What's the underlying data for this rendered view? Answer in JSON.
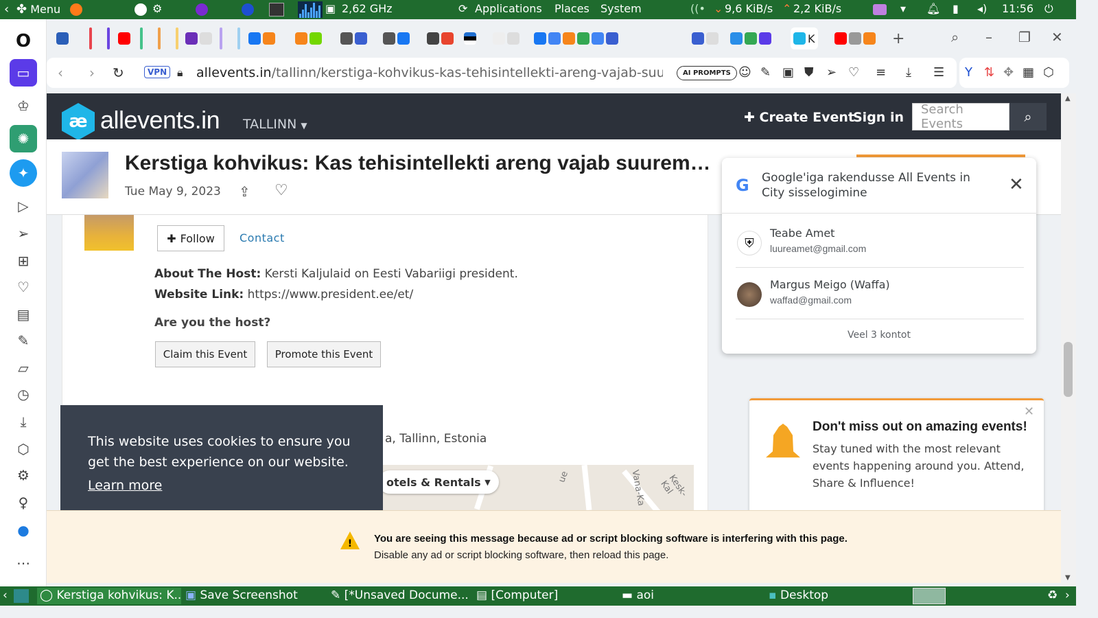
{
  "os_panel": {
    "menu_label": "Menu",
    "cpu_freq": "2,62 GHz",
    "applications": "Applications",
    "places": "Places",
    "system": "System",
    "net_down": "9,6 KiB/s",
    "net_up": "2,2 KiB/s",
    "clock": "11:56"
  },
  "browser": {
    "active_tab_letter": "K",
    "vpn_label": "VPN",
    "url_domain": "allevents.in",
    "url_path": "/tallinn/kerstiga-kohvikus-kas-tehisintellekti-areng-vajab-suurem",
    "ai_prompts": "AI PROMPTS"
  },
  "site": {
    "logo_mark": "æ",
    "logo_text": "allevents.in",
    "city": "TALLINN",
    "create_event": "Create Event",
    "sign_in": "Sign in",
    "search_placeholder": "Search Events"
  },
  "event": {
    "title": "Kerstiga kohvikus: Kas tehisintellekti areng vajab suurem…",
    "date": "Tue May 9, 2023"
  },
  "host": {
    "follow_label": "Follow",
    "contact_label": "Contact",
    "about_label": "About The Host:",
    "about_text": "Kersti Kaljulaid on Eesti Vabariigi president.",
    "website_label": "Website Link:",
    "website_url": "https://www.president.ee/et/",
    "question": "Are you the host?",
    "claim_label": "Claim this Event",
    "promote_label": "Promote this Event",
    "address_tail": "a, Tallinn, Estonia"
  },
  "map": {
    "hotels_label": "otels & Rentals",
    "labels": [
      "ue",
      "Vana-Ka",
      "Kesk-Kal"
    ]
  },
  "cookie": {
    "text": "This website uses cookies to ensure you get the best experience on our website.",
    "learn_more": "Learn more"
  },
  "google_signin": {
    "title": "Google'iga rakendusse All Events in City sisselogimine",
    "accounts": [
      {
        "name": "Teabe Amet",
        "email": "luureamet@gmail.com"
      },
      {
        "name": "Margus Meigo (Waffa)",
        "email": "waffad@gmail.com"
      }
    ],
    "more": "Veel 3 kontot"
  },
  "notify": {
    "title": "Don't miss out on amazing events!",
    "text": "Stay tuned with the most relevant events happening around you. Attend, Share & Influence!"
  },
  "adblock_warning": {
    "title": "You are seeing this message because ad or script blocking software is interfering with this page.",
    "body": "Disable any ad or script blocking software, then reload this page."
  },
  "taskbar": {
    "items": [
      "Kerstiga kohvikus: K...",
      "Save Screenshot",
      "[*Unsaved Docume...",
      "[Computer]",
      "aoi",
      "Desktop"
    ]
  },
  "colors": {
    "os_panel": "#1f6b2e",
    "site_header": "#2c313a",
    "brand_accent": "#1fb6e8",
    "cookie_bg": "#39414e",
    "notify_accent": "#f29a38",
    "warn_bg": "#fdf3e3"
  }
}
